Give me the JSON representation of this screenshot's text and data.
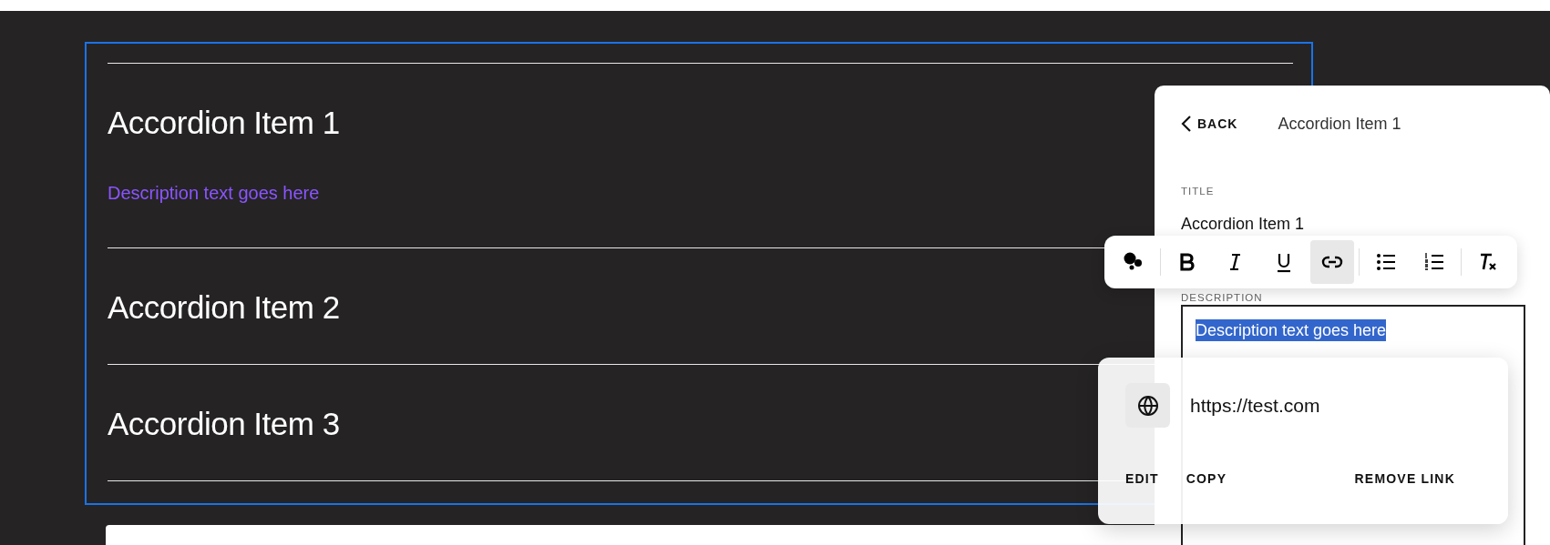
{
  "accordion": {
    "selected": true,
    "items": [
      {
        "title": "Accordion Item 1",
        "expanded": true,
        "description": "Description text goes here"
      },
      {
        "title": "Accordion Item 2",
        "expanded": false
      },
      {
        "title": "Accordion Item 3",
        "expanded": false
      }
    ]
  },
  "panel": {
    "back_label": "BACK",
    "title": "Accordion Item 1",
    "title_field": {
      "label": "TITLE",
      "value": "Accordion Item 1"
    },
    "description_field": {
      "label": "DESCRIPTION",
      "value": "Description text goes here",
      "text_selected": true
    }
  },
  "toolbar": {
    "tools": [
      {
        "kind": "color",
        "selected": false
      },
      {
        "kind": "bold",
        "selected": false
      },
      {
        "kind": "italic",
        "selected": false
      },
      {
        "kind": "underline",
        "selected": false
      },
      {
        "kind": "link",
        "selected": true
      },
      {
        "kind": "bullets",
        "selected": false
      },
      {
        "kind": "numbers",
        "selected": false
      },
      {
        "kind": "clear",
        "selected": false
      }
    ]
  },
  "link_popup": {
    "url": "https://test.com",
    "actions": [
      {
        "kind": "edit",
        "label": "EDIT"
      },
      {
        "kind": "copy",
        "label": "COPY"
      },
      {
        "kind": "remove",
        "label": "REMOVE LINK"
      }
    ]
  }
}
